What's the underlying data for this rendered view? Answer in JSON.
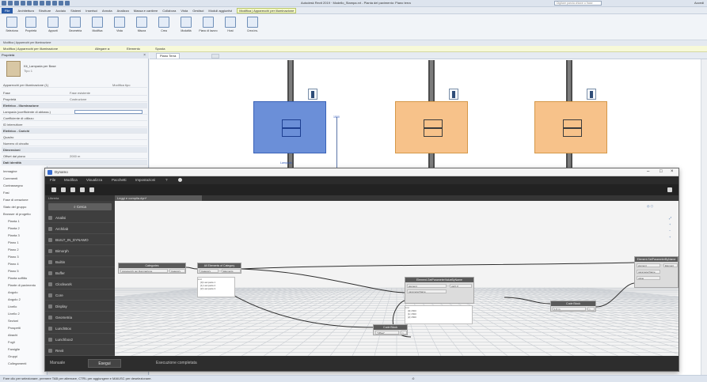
{
  "revit": {
    "title_bar": "Autodesk Revit 2019 · Modello_Stampa.rvt - Pianta del pavimento: Piano terra",
    "search_placeholder": "Digitare parola chiave o frase",
    "user_label": "Accedi",
    "menu": [
      "File",
      "Architettura",
      "Strutture",
      "Acciaio",
      "Sistemi",
      "Inserisci",
      "Annota",
      "Analizza",
      "Massa e cantiere",
      "Collabora",
      "Vista",
      "Gestisci",
      "Moduli aggiuntivi",
      "Modifica | Apparecchi per illuminazione"
    ],
    "ribbon_buttons": [
      "Seleziona",
      "Proprietà",
      "Appunti",
      "Geometria",
      "Modifica",
      "Vista",
      "Misura",
      "Crea",
      "Modalità",
      "Piano di lavoro",
      "Host",
      "Crea ins."
    ],
    "panel_strip": "Modifica | Apparecchi per illuminazione",
    "option_bar": {
      "label": "Modifica | Apparecchi per illuminazione",
      "field_label": "Allegare a:",
      "field_value": "Elemento",
      "extra": "Sposta"
    }
  },
  "properties": {
    "header": "Proprietà",
    "type_name": "Kit_Lampada per Base",
    "type_sub": "Tipo 1",
    "selector": "Apparecchi per illuminazione (1)",
    "edit_type": "Modifica tipo",
    "rows": [
      {
        "k": "Fase",
        "v": "Fase esistente",
        "sec": false
      },
      {
        "k": "Proprietà",
        "v": "Costruzione",
        "sec": false
      },
      {
        "k": "Elettrico - Illuminazione",
        "v": "",
        "sec": true
      },
      {
        "k": "Lampada (coefficiente di abbass.)",
        "v": "",
        "sec": false,
        "field": true
      },
      {
        "k": "Coefficiente di utilizzo",
        "v": "",
        "sec": false
      },
      {
        "k": "ID interruttore",
        "v": "",
        "sec": false
      },
      {
        "k": "Elettrico - Carichi",
        "v": "",
        "sec": true
      },
      {
        "k": "Quadro",
        "v": "",
        "sec": false
      },
      {
        "k": "Numero di circuito",
        "v": "",
        "sec": false
      },
      {
        "k": "Dimensioni",
        "v": "",
        "sec": true
      },
      {
        "k": "Offset dal piano",
        "v": "2000 m",
        "sec": false
      },
      {
        "k": "Dati identità",
        "v": "",
        "sec": true
      }
    ]
  },
  "browser": {
    "items": [
      "Immagine",
      "Commenti",
      "Contrassegno",
      "Fasi",
      "Fase di creazione",
      "Stato del gruppo",
      "Browser di progetto",
      "Pianta 1",
      "Pianta 2",
      "Pianta 3",
      "Piano 1",
      "Piano 2",
      "Piano 3",
      "Piano 4",
      "Piano 5",
      "Pianta soffitto",
      "Piante di pavimento",
      "Angolo",
      "Angolo 2",
      "Livello",
      "Livello 2",
      "Sezioni",
      "Prospetti",
      "Abachi",
      "Fogli",
      "Famiglie",
      "Gruppi",
      "Collegamenti"
    ]
  },
  "view": {
    "tab_label": "Piano Terra",
    "blue_tag_label": "Lampada",
    "measure_label": "1500"
  },
  "dynamo": {
    "title": "Dynamo",
    "menu": [
      "File",
      "Modifica",
      "Visualizza",
      "Pacchetti",
      "Impostazioni",
      "?"
    ],
    "library_tab": "Libreria",
    "workspace_tab": "Leggi e compila.dyn*",
    "search": "Cerca",
    "categories": [
      "Analisi",
      "Archilab",
      "BUILT_IN_DYNAMO",
      "Bimorph",
      "Builtin",
      "Buffer",
      "Clockwork",
      "Core",
      "Display",
      "Geometria",
      "LunchBox",
      "Lunchbox2",
      "Revit"
    ],
    "bottom": {
      "mode": "Manuale",
      "run": "Esegui",
      "status": "Esecuzione completata"
    },
    "nodes": [
      {
        "title": "Categories",
        "port": "Apparecchi per illuminazione",
        "out": "Category"
      },
      {
        "title": "All Elements of Category",
        "port": "Category",
        "out": "Elements"
      },
      {
        "title": "Element.SetParameterByName",
        "port": "element",
        "port2": "parameterName",
        "port3": "value",
        "out": "Element"
      },
      {
        "title": "Code Block",
        "port": "1.5 m",
        "out": ">"
      },
      {
        "title": "Element.GetParameterValueByName",
        "port": "element",
        "port2": "parameterName",
        "out": "var[]..[]"
      },
      {
        "title": "Code Block",
        "port": "\"Offset\"",
        "out": ">"
      }
    ],
    "preview_list": [
      "List",
      "[0] Lampada 1",
      "[1] Lampada 2",
      "[2] Lampada 3"
    ],
    "preview_list2": [
      "List",
      "[0] 1500",
      "[1] 1500",
      "[2] 1500"
    ]
  },
  "statusbar": {
    "left": "Fare clic per selezionare, premere TAB per alternare, CTRL per aggiungere e MAIUSC per deselezionare.",
    "right": ":0"
  }
}
